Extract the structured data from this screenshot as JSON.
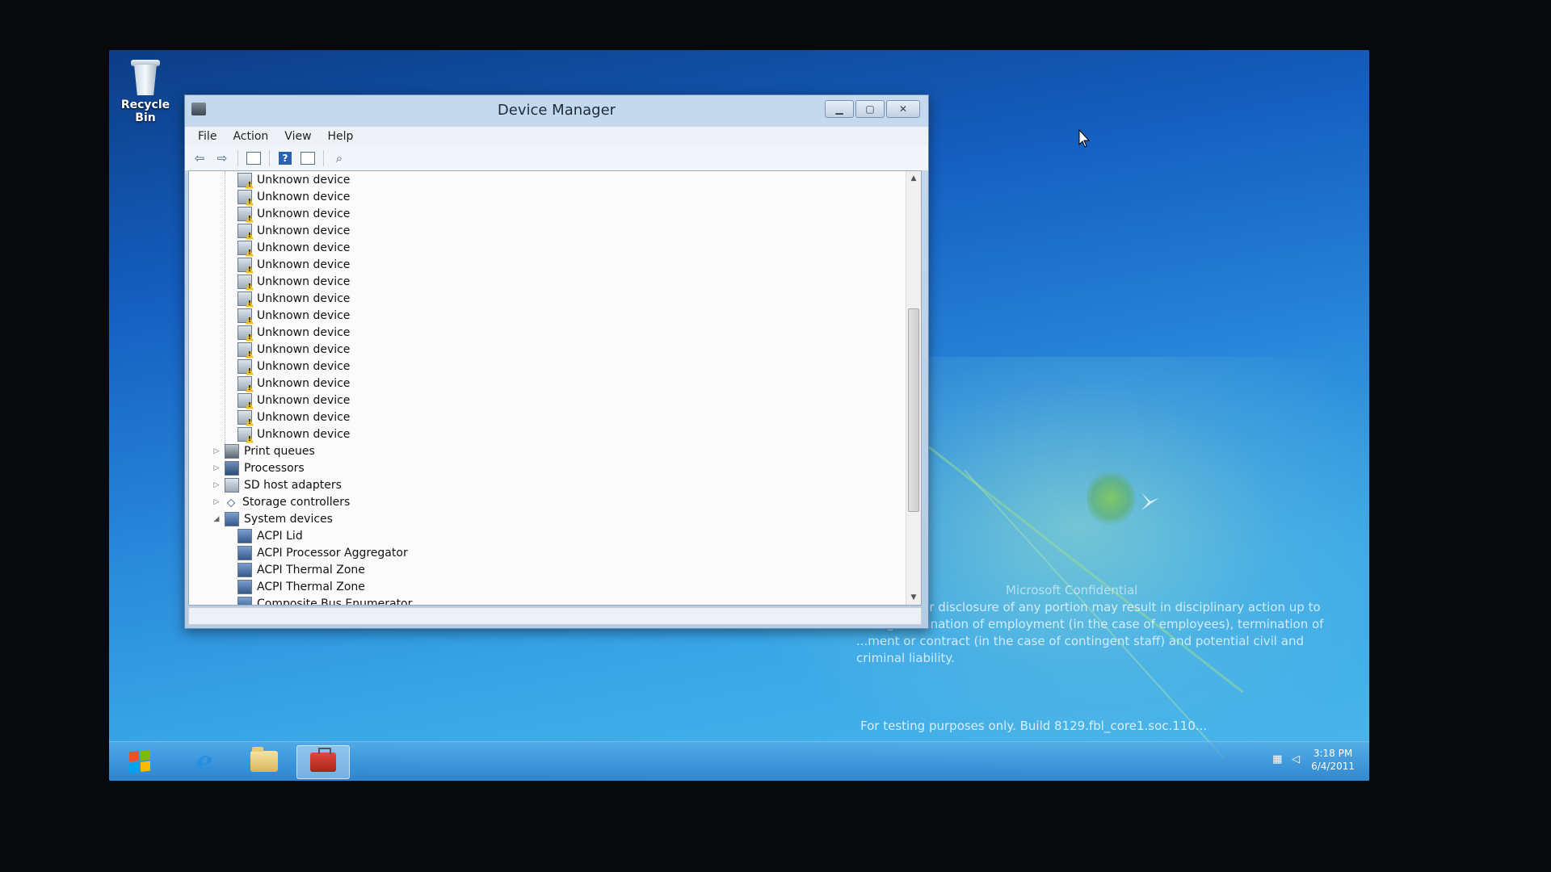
{
  "desktop": {
    "recycle_bin_label": "Recycle Bin"
  },
  "window": {
    "title": "Device Manager",
    "menu": [
      "File",
      "Action",
      "View",
      "Help"
    ],
    "tree": [
      {
        "label": "Unknown device",
        "level": 2,
        "icon": "warning-device-icon"
      },
      {
        "label": "Unknown device",
        "level": 2,
        "icon": "warning-device-icon"
      },
      {
        "label": "Unknown device",
        "level": 2,
        "icon": "warning-device-icon"
      },
      {
        "label": "Unknown device",
        "level": 2,
        "icon": "warning-device-icon"
      },
      {
        "label": "Unknown device",
        "level": 2,
        "icon": "warning-device-icon"
      },
      {
        "label": "Unknown device",
        "level": 2,
        "icon": "warning-device-icon"
      },
      {
        "label": "Unknown device",
        "level": 2,
        "icon": "warning-device-icon"
      },
      {
        "label": "Unknown device",
        "level": 2,
        "icon": "warning-device-icon"
      },
      {
        "label": "Unknown device",
        "level": 2,
        "icon": "warning-device-icon"
      },
      {
        "label": "Unknown device",
        "level": 2,
        "icon": "warning-device-icon"
      },
      {
        "label": "Unknown device",
        "level": 2,
        "icon": "warning-device-icon"
      },
      {
        "label": "Unknown device",
        "level": 2,
        "icon": "warning-device-icon"
      },
      {
        "label": "Unknown device",
        "level": 2,
        "icon": "warning-device-icon"
      },
      {
        "label": "Unknown device",
        "level": 2,
        "icon": "warning-device-icon"
      },
      {
        "label": "Unknown device",
        "level": 2,
        "icon": "warning-device-icon"
      },
      {
        "label": "Unknown device",
        "level": 2,
        "icon": "warning-device-icon"
      },
      {
        "label": "Print queues",
        "level": 1,
        "icon": "printer-icon",
        "expander": "collapsed"
      },
      {
        "label": "Processors",
        "level": 1,
        "icon": "processor-icon",
        "expander": "collapsed"
      },
      {
        "label": "SD host adapters",
        "level": 1,
        "icon": "sd-adapter-icon",
        "expander": "collapsed"
      },
      {
        "label": "Storage controllers",
        "level": 1,
        "icon": "storage-controller-icon",
        "expander": "collapsed"
      },
      {
        "label": "System devices",
        "level": 1,
        "icon": "system-devices-icon",
        "expander": "expanded"
      },
      {
        "label": "ACPI Lid",
        "level": 2,
        "icon": "system-device-icon"
      },
      {
        "label": "ACPI Processor Aggregator",
        "level": 2,
        "icon": "system-device-icon"
      },
      {
        "label": "ACPI Thermal Zone",
        "level": 2,
        "icon": "system-device-icon"
      },
      {
        "label": "ACPI Thermal Zone",
        "level": 2,
        "icon": "system-device-icon"
      },
      {
        "label": "Composite Bus Enumerator",
        "level": 2,
        "icon": "system-device-icon"
      }
    ]
  },
  "watermark": {
    "title": "Microsoft Confidential",
    "body": "...ized use or disclosure of any portion may result in disciplinary action up to ...ding termination of employment (in the case of employees), termination of ...ment or contract (in the case of contingent staff) and potential civil and criminal liability.",
    "build": "For testing purposes only. Build 8129.fbl_core1.soc.110..."
  },
  "taskbar": {
    "apps": [
      "internet-explorer-icon",
      "file-explorer-icon",
      "toolbox-icon"
    ],
    "clock_time": "3:18 PM",
    "clock_date": "6/4/2011"
  }
}
